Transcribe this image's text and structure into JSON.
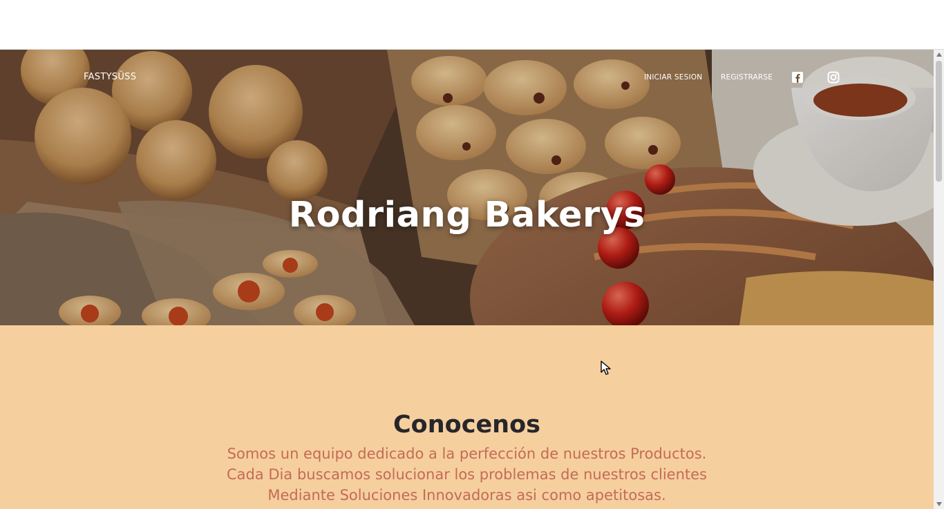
{
  "nav": {
    "brand": "FASTYSÜSS",
    "login": "INICIAR SESION",
    "register": "REGISTRARSE",
    "icons": [
      "facebook-icon",
      "instagram-icon"
    ]
  },
  "hero": {
    "title": "Rodriang Bakerys"
  },
  "about": {
    "title": "Conocenos",
    "lines": [
      "Somos un equipo dedicado a la perfección de nuestros Productos.",
      "Cada Dia buscamos solucionar los problemas de nuestros clientes",
      "Mediante Soluciones Innovadoras asi como apetitosas."
    ]
  },
  "colors": {
    "about_background": "#f6cf9f",
    "about_title": "#26262b",
    "about_text": "#c46b54",
    "hero_text": "#ffffff"
  }
}
